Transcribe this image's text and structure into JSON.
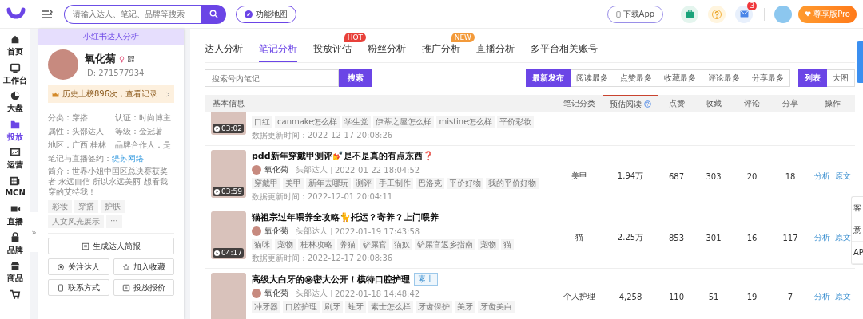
{
  "topbar": {
    "search": {
      "placeholder": "请输入达人、笔记、品牌等搜索"
    },
    "feature_map": "功能地图",
    "download": "下载App",
    "mail_badge": "3",
    "plan": "尊享版Pro"
  },
  "nav": [
    {
      "label": "首页",
      "selected": false
    },
    {
      "label": "工作台",
      "selected": false
    },
    {
      "label": "大盘",
      "selected": false
    },
    {
      "label": "投放",
      "selected": true
    },
    {
      "label": "运营",
      "selected": false
    },
    {
      "label": "MCN",
      "selected": false
    },
    {
      "label": "直播",
      "selected": false
    },
    {
      "label": "品牌",
      "selected": false
    },
    {
      "label": "商品",
      "selected": false
    },
    {
      "selected": false
    }
  ],
  "collapse_toggle": "»",
  "profile": {
    "header": "小红书达人分析",
    "name": "氧化菊",
    "id": "ID: 271577934",
    "history": "历史上榜896次，查看记录",
    "info": [
      [
        "分类：穿搭",
        "认证：时尚博主"
      ],
      [
        "属性：头部达人",
        "等级：金冠薯"
      ],
      [
        "地区：广西 桂林",
        "品牌合作人：是"
      ]
    ],
    "contract_label": "笔记与直播签约：",
    "contract_link": "缇苏网络",
    "bio": "简介：世界小姐中国区总决赛获奖者 永远自信 所以永远美丽 想看我穿的艾特我！",
    "tags": [
      "彩妆",
      "穿搭",
      "护肤",
      "人文风光展示",
      "···"
    ],
    "actions": [
      "生成达人简报",
      "关注达人",
      "加入收藏",
      "联系方式",
      "投放报价"
    ]
  },
  "tabs": [
    {
      "label": "达人分析",
      "selected": false
    },
    {
      "label": "笔记分析",
      "selected": true
    },
    {
      "label": "投放评估",
      "selected": false,
      "badge": "HOT"
    },
    {
      "label": "粉丝分析",
      "selected": false
    },
    {
      "label": "推广分析",
      "selected": false,
      "badge": "NEW"
    },
    {
      "label": "直播分析",
      "selected": false
    },
    {
      "label": "多平台相关账号",
      "selected": false
    }
  ],
  "note_search": {
    "placeholder": "搜索号内笔记",
    "button": "搜索"
  },
  "sort_options": [
    {
      "label": "最新发布",
      "selected": true
    },
    {
      "label": "阅读最多",
      "selected": false
    },
    {
      "label": "点赞最多",
      "selected": false
    },
    {
      "label": "收藏最多",
      "selected": false
    },
    {
      "label": "评论最多",
      "selected": false
    },
    {
      "label": "分享最多",
      "selected": false
    }
  ],
  "view_options": [
    {
      "label": "列表",
      "selected": true
    },
    {
      "label": "大图",
      "selected": false
    }
  ],
  "table": {
    "columns": [
      {
        "label": "基本信息",
        "highlighted": false
      },
      {
        "label": "笔记分类",
        "highlighted": false
      },
      {
        "label": "预估阅读",
        "highlighted": true,
        "help": true
      },
      {
        "label": "点赞",
        "highlighted": false
      },
      {
        "label": "收藏",
        "highlighted": false
      },
      {
        "label": "评论",
        "highlighted": false
      },
      {
        "label": "分享",
        "highlighted": false
      },
      {
        "label": "操作",
        "highlighted": false
      }
    ],
    "rows": [
      {
        "partial": true,
        "duration": "03:02",
        "tags": [
          "口红",
          "canmake怎么样",
          "学生党",
          "伊蒂之屋怎么样",
          "mistine怎么样",
          "平价彩妆"
        ],
        "update_label": "数据更新时间：",
        "update_time": "2022-12-17 20:08:26"
      },
      {
        "partial": false,
        "title": "pdd新年穿戴甲测评💅是不是真的有点东西❓",
        "author": "氧化菊",
        "level": "头部达人",
        "published": "2022-01-22 18:04:52",
        "duration": "03:59",
        "tags": [
          "穿戴甲",
          "美甲",
          "新年去哪玩",
          "测评",
          "手工制作",
          "巴洛克",
          "平价好物",
          "我的平价好物"
        ],
        "update_label": "数据更新时间：",
        "update_time": "2022-12-01 20:04:11",
        "category": "美甲",
        "reads": "1.94万",
        "likes": "687",
        "saves": "303",
        "comments": "20",
        "shares": "18",
        "actions": [
          "分析",
          "原文"
        ]
      },
      {
        "partial": false,
        "title": "猫祖宗过年喂养全攻略🐈托运？寄养？上门喂养",
        "author": "氧化菊",
        "level": "头部达人",
        "published": "2022-01-19 17:43:58",
        "duration": "04:17",
        "tags": [
          "猫咪",
          "宠物",
          "桂林攻略",
          "养猫",
          "铲屎官",
          "猫奴",
          "铲屎官返乡指南",
          "宠物",
          "猫"
        ],
        "update_label": "数据更新时间：",
        "update_time": "2022-12-17 20:08:36",
        "category": "猫",
        "reads": "2.25万",
        "likes": "853",
        "saves": "301",
        "comments": "16",
        "shares": "117",
        "actions": [
          "分析",
          "原文"
        ]
      },
      {
        "partial": false,
        "title": "高级大白牙的㊙密大公开！模特口腔护理",
        "brand": "素士",
        "author": "氧化菊",
        "level": "头部达人",
        "published": "2022-01-18 14:48:42",
        "tags": [
          "冲牙器",
          "口腔护理",
          "刷牙",
          "蛀牙",
          "素士怎么样",
          "牙齿保护",
          "美牙",
          "牙齿美白"
        ],
        "category": "个人护理",
        "reads": "4,258",
        "likes": "110",
        "saves": "51",
        "comments": "19",
        "shares": "7",
        "actions": [
          "分析",
          "原文"
        ]
      }
    ]
  },
  "side_tools": [
    "客",
    "意",
    "AP"
  ]
}
